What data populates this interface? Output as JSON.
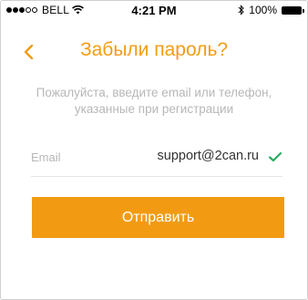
{
  "status_bar": {
    "carrier": "BELL",
    "time": "4:21 PM",
    "battery": "100%",
    "signal_bars": 2,
    "icons": [
      "signal-dots-icon",
      "wifi-icon",
      "bluetooth-icon",
      "battery-icon"
    ]
  },
  "nav": {
    "title": "Забыли пароль?",
    "back_icon": "chevron-left-icon"
  },
  "subtitle": "Пожалуйста, введите email или телефон, указанные при регистрации",
  "form": {
    "email_label": "Email",
    "email_value": "support@2can.ru",
    "valid_icon": "check-icon"
  },
  "submit_label": "Отправить",
  "colors": {
    "accent": "#f29b12",
    "muted_text": "#b7b7b7",
    "valid": "#27ae60"
  }
}
